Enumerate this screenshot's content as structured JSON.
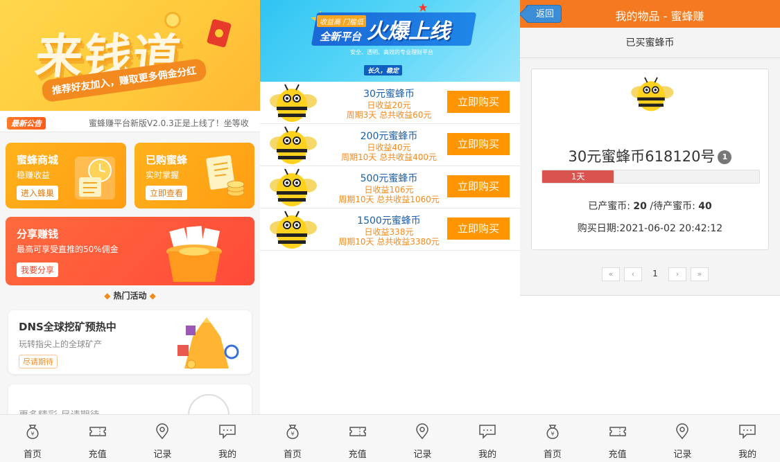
{
  "home": {
    "hero_title": "来钱道",
    "hero_sub": "推荐好友加入，赚取更多佣金分红",
    "notice_tag": "最新公告",
    "notice_text": "蜜蜂赚平台新版V2.0.3正是上线了！坐等收",
    "cards": [
      {
        "title": "蜜蜂商城",
        "sub": "稳赚收益",
        "btn": "进入蜂巢"
      },
      {
        "title": "已购蜜蜂",
        "sub": "实时掌握",
        "btn": "立即查看"
      },
      {
        "title": "分享赚钱",
        "sub": "最高可享受直推的50%佣金",
        "btn": "我要分享"
      }
    ],
    "hot_label": "热门活动",
    "dns": {
      "title": "DNS全球挖矿预热中",
      "sub": "玩转指尖上的全球矿产",
      "btn": "尽请期待"
    },
    "more_text": "更多精彩 尽请期待"
  },
  "shop": {
    "banner": {
      "small": "收益高 门槛低",
      "mid": "全新平台",
      "big": "火爆上线",
      "line": "安全、透明、高效的专业理财平台",
      "chip": "长久，稳定"
    },
    "products": [
      {
        "name": "30元蜜蜂币",
        "daily": "日收益20元",
        "period": "周期3天 总共收益60元",
        "buy": "立即购买"
      },
      {
        "name": "200元蜜蜂币",
        "daily": "日收益40元",
        "period": "周期10天 总共收益400元",
        "buy": "立即购买"
      },
      {
        "name": "500元蜜蜂币",
        "daily": "日收益106元",
        "period": "周期10天 总共收益1060元",
        "buy": "立即购买"
      },
      {
        "name": "1500元蜜蜂币",
        "daily": "日收益338元",
        "period": "周期10天 总共收益3380元",
        "buy": "立即购买"
      }
    ]
  },
  "items": {
    "back": "返回",
    "title": "我的物品 - 蜜蜂赚",
    "section": "已买蜜蜂币",
    "item_name": "30元蜜蜂币618120号",
    "badge": "1",
    "progress_label": "1天",
    "progress_fraction": 0.33,
    "produced_label": "已产蜜币: ",
    "produced_value": "20",
    "pending_label": " /待产蜜币: ",
    "pending_value": "40",
    "date": "购买日期:2021-06-02 20:42:12",
    "pager": {
      "first": "«",
      "prev": "‹",
      "current": "1",
      "next": "›",
      "last": "»"
    }
  },
  "tabs": [
    {
      "label": "首页",
      "icon": "money-bag-icon"
    },
    {
      "label": "充值",
      "icon": "ticket-icon"
    },
    {
      "label": "记录",
      "icon": "location-pin-icon"
    },
    {
      "label": "我的",
      "icon": "chat-bubble-icon"
    }
  ],
  "colors": {
    "orange": "#ff9500",
    "nav_orange": "#f47920",
    "back_blue": "#3c8dd6",
    "progress_red": "#d9534f",
    "link_blue": "#1a5fa8"
  }
}
